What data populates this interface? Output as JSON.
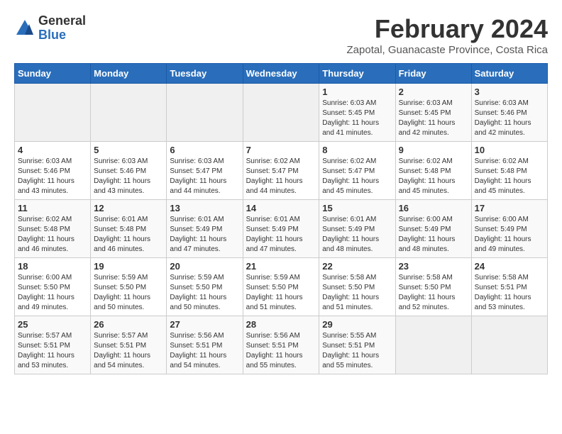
{
  "logo": {
    "general": "General",
    "blue": "Blue"
  },
  "title": "February 2024",
  "subtitle": "Zapotal, Guanacaste Province, Costa Rica",
  "days_of_week": [
    "Sunday",
    "Monday",
    "Tuesday",
    "Wednesday",
    "Thursday",
    "Friday",
    "Saturday"
  ],
  "weeks": [
    [
      {
        "day": "",
        "empty": true
      },
      {
        "day": "",
        "empty": true
      },
      {
        "day": "",
        "empty": true
      },
      {
        "day": "",
        "empty": true
      },
      {
        "day": "1",
        "sunrise": "6:03 AM",
        "sunset": "5:45 PM",
        "daylight": "11 hours and 41 minutes."
      },
      {
        "day": "2",
        "sunrise": "6:03 AM",
        "sunset": "5:45 PM",
        "daylight": "11 hours and 42 minutes."
      },
      {
        "day": "3",
        "sunrise": "6:03 AM",
        "sunset": "5:46 PM",
        "daylight": "11 hours and 42 minutes."
      }
    ],
    [
      {
        "day": "4",
        "sunrise": "6:03 AM",
        "sunset": "5:46 PM",
        "daylight": "11 hours and 43 minutes."
      },
      {
        "day": "5",
        "sunrise": "6:03 AM",
        "sunset": "5:46 PM",
        "daylight": "11 hours and 43 minutes."
      },
      {
        "day": "6",
        "sunrise": "6:03 AM",
        "sunset": "5:47 PM",
        "daylight": "11 hours and 44 minutes."
      },
      {
        "day": "7",
        "sunrise": "6:02 AM",
        "sunset": "5:47 PM",
        "daylight": "11 hours and 44 minutes."
      },
      {
        "day": "8",
        "sunrise": "6:02 AM",
        "sunset": "5:47 PM",
        "daylight": "11 hours and 45 minutes."
      },
      {
        "day": "9",
        "sunrise": "6:02 AM",
        "sunset": "5:48 PM",
        "daylight": "11 hours and 45 minutes."
      },
      {
        "day": "10",
        "sunrise": "6:02 AM",
        "sunset": "5:48 PM",
        "daylight": "11 hours and 45 minutes."
      }
    ],
    [
      {
        "day": "11",
        "sunrise": "6:02 AM",
        "sunset": "5:48 PM",
        "daylight": "11 hours and 46 minutes."
      },
      {
        "day": "12",
        "sunrise": "6:01 AM",
        "sunset": "5:48 PM",
        "daylight": "11 hours and 46 minutes."
      },
      {
        "day": "13",
        "sunrise": "6:01 AM",
        "sunset": "5:49 PM",
        "daylight": "11 hours and 47 minutes."
      },
      {
        "day": "14",
        "sunrise": "6:01 AM",
        "sunset": "5:49 PM",
        "daylight": "11 hours and 47 minutes."
      },
      {
        "day": "15",
        "sunrise": "6:01 AM",
        "sunset": "5:49 PM",
        "daylight": "11 hours and 48 minutes."
      },
      {
        "day": "16",
        "sunrise": "6:00 AM",
        "sunset": "5:49 PM",
        "daylight": "11 hours and 48 minutes."
      },
      {
        "day": "17",
        "sunrise": "6:00 AM",
        "sunset": "5:49 PM",
        "daylight": "11 hours and 49 minutes."
      }
    ],
    [
      {
        "day": "18",
        "sunrise": "6:00 AM",
        "sunset": "5:50 PM",
        "daylight": "11 hours and 49 minutes."
      },
      {
        "day": "19",
        "sunrise": "5:59 AM",
        "sunset": "5:50 PM",
        "daylight": "11 hours and 50 minutes."
      },
      {
        "day": "20",
        "sunrise": "5:59 AM",
        "sunset": "5:50 PM",
        "daylight": "11 hours and 50 minutes."
      },
      {
        "day": "21",
        "sunrise": "5:59 AM",
        "sunset": "5:50 PM",
        "daylight": "11 hours and 51 minutes."
      },
      {
        "day": "22",
        "sunrise": "5:58 AM",
        "sunset": "5:50 PM",
        "daylight": "11 hours and 51 minutes."
      },
      {
        "day": "23",
        "sunrise": "5:58 AM",
        "sunset": "5:50 PM",
        "daylight": "11 hours and 52 minutes."
      },
      {
        "day": "24",
        "sunrise": "5:58 AM",
        "sunset": "5:51 PM",
        "daylight": "11 hours and 53 minutes."
      }
    ],
    [
      {
        "day": "25",
        "sunrise": "5:57 AM",
        "sunset": "5:51 PM",
        "daylight": "11 hours and 53 minutes."
      },
      {
        "day": "26",
        "sunrise": "5:57 AM",
        "sunset": "5:51 PM",
        "daylight": "11 hours and 54 minutes."
      },
      {
        "day": "27",
        "sunrise": "5:56 AM",
        "sunset": "5:51 PM",
        "daylight": "11 hours and 54 minutes."
      },
      {
        "day": "28",
        "sunrise": "5:56 AM",
        "sunset": "5:51 PM",
        "daylight": "11 hours and 55 minutes."
      },
      {
        "day": "29",
        "sunrise": "5:55 AM",
        "sunset": "5:51 PM",
        "daylight": "11 hours and 55 minutes."
      },
      {
        "day": "",
        "empty": true
      },
      {
        "day": "",
        "empty": true
      }
    ]
  ]
}
